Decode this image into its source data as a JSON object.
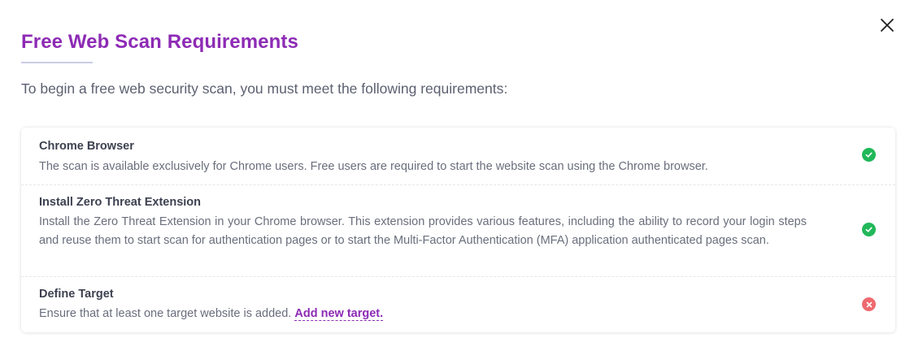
{
  "modal": {
    "title": "Free Web Scan Requirements",
    "intro": "To begin a free web security scan, you must meet the following requirements:",
    "close_icon": "close-icon"
  },
  "requirements": [
    {
      "title": "Chrome Browser",
      "description": "The scan is available exclusively for Chrome users. Free users are required to start the website scan using the Chrome browser.",
      "status": "met",
      "status_icon": "check-circle-icon"
    },
    {
      "title": "Install Zero Threat Extension",
      "description": "Install the Zero Threat Extension in your Chrome browser. This extension provides various features, including the ability to record your login steps and reuse them to start scan for authentication pages or to start the Multi-Factor Authentication (MFA) application authenticated pages scan.",
      "status": "met",
      "status_icon": "check-circle-icon"
    },
    {
      "title": "Define Target",
      "description": "Ensure that at least one target website is added.",
      "link_label": "Add new target.",
      "status": "not-met",
      "status_icon": "x-circle-icon"
    }
  ],
  "colors": {
    "accent": "#8d2bb5",
    "success": "#21b85a",
    "error": "#ee6a6f"
  }
}
